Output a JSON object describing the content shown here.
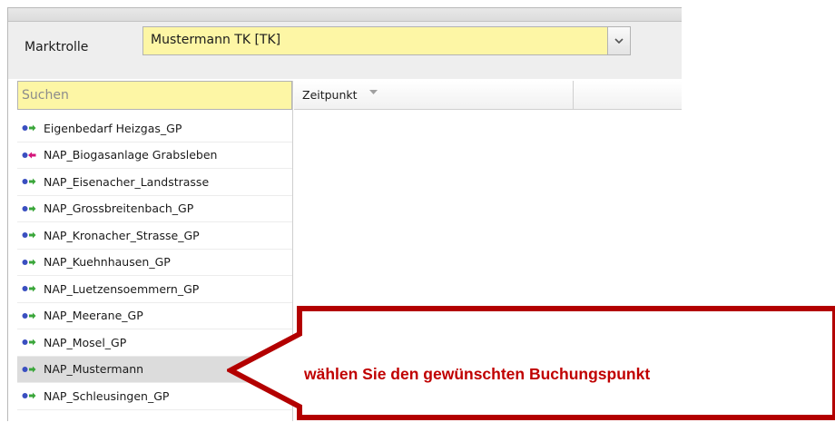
{
  "filter": {
    "marktrolle_label": "Marktrolle",
    "marktrolle_value": "Mustermann TK [TK]"
  },
  "search": {
    "placeholder": "Suchen"
  },
  "list": {
    "items": [
      {
        "label": "Eigenbedarf Heizgas_GP",
        "arrow": "green",
        "selected": false
      },
      {
        "label": "NAP_Biogasanlage Grabsleben",
        "arrow": "magenta",
        "selected": false
      },
      {
        "label": "NAP_Eisenacher_Landstrasse",
        "arrow": "green",
        "selected": false
      },
      {
        "label": "NAP_Grossbreitenbach_GP",
        "arrow": "green",
        "selected": false
      },
      {
        "label": "NAP_Kronacher_Strasse_GP",
        "arrow": "green",
        "selected": false
      },
      {
        "label": "NAP_Kuehnhausen_GP",
        "arrow": "green",
        "selected": false
      },
      {
        "label": "NAP_Luetzensoemmern_GP",
        "arrow": "green",
        "selected": false
      },
      {
        "label": "NAP_Meerane_GP",
        "arrow": "green",
        "selected": false
      },
      {
        "label": "NAP_Mosel_GP",
        "arrow": "green",
        "selected": false
      },
      {
        "label": "NAP_Mustermann",
        "arrow": "green",
        "selected": true
      },
      {
        "label": "NAP_Schleusingen_GP",
        "arrow": "green",
        "selected": false
      }
    ]
  },
  "grid": {
    "column_zeitpunkt": "Zeitpunkt"
  },
  "callout": {
    "text": "wählen Sie den gewünschten  Buchungspunkt"
  },
  "colors": {
    "yellow_field": "#fdf6a5",
    "callout_red": "#c00000",
    "arrow_green": "#3aa63a",
    "arrow_magenta": "#d4147a",
    "dot_blue": "#3a4fc0"
  },
  "icons": {
    "combo_trigger": "chevron-down-icon",
    "sort": "sort-down-icon",
    "item_marker": "dot-arrow-icon"
  }
}
